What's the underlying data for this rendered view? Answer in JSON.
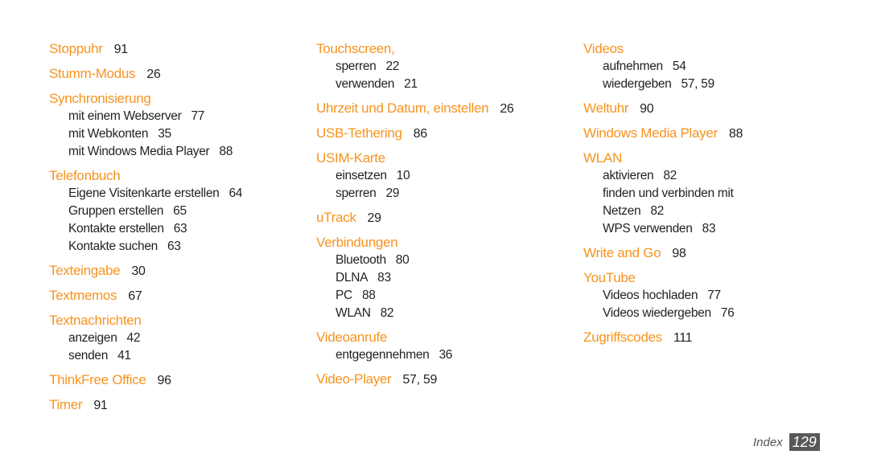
{
  "colors": {
    "accent": "#F7931E",
    "text": "#231F20",
    "page_box": "#58595B"
  },
  "columns": [
    {
      "entries": [
        {
          "term": "Stoppuhr",
          "pages": "91",
          "subs": []
        },
        {
          "term": "Stumm-Modus",
          "pages": "26",
          "subs": []
        },
        {
          "term": "Synchronisierung",
          "pages": "",
          "subs": [
            {
              "term": "mit einem Webserver",
              "pages": "77"
            },
            {
              "term": "mit Webkonten",
              "pages": "35"
            },
            {
              "term": "mit Windows Media Player",
              "pages": "88"
            }
          ]
        },
        {
          "term": "Telefonbuch",
          "pages": "",
          "subs": [
            {
              "term": "Eigene Visitenkarte erstellen",
              "pages": "64"
            },
            {
              "term": "Gruppen erstellen",
              "pages": "65"
            },
            {
              "term": "Kontakte erstellen",
              "pages": "63"
            },
            {
              "term": "Kontakte suchen",
              "pages": "63"
            }
          ]
        },
        {
          "term": "Texteingabe",
          "pages": "30",
          "subs": []
        },
        {
          "term": "Textmemos",
          "pages": "67",
          "subs": []
        },
        {
          "term": "Textnachrichten",
          "pages": "",
          "subs": [
            {
              "term": "anzeigen",
              "pages": "42"
            },
            {
              "term": "senden",
              "pages": "41"
            }
          ]
        },
        {
          "term": "ThinkFree Office",
          "pages": "96",
          "subs": []
        },
        {
          "term": "Timer",
          "pages": "91",
          "subs": []
        }
      ]
    },
    {
      "entries": [
        {
          "term": "Touchscreen,",
          "pages": "",
          "subs": [
            {
              "term": "sperren",
              "pages": "22"
            },
            {
              "term": "verwenden",
              "pages": "21"
            }
          ]
        },
        {
          "term": "Uhrzeit und Datum, einstellen",
          "pages": "26",
          "subs": []
        },
        {
          "term": "USB-Tethering",
          "pages": "86",
          "subs": []
        },
        {
          "term": "USIM-Karte",
          "pages": "",
          "subs": [
            {
              "term": "einsetzen",
              "pages": "10"
            },
            {
              "term": "sperren",
              "pages": "29"
            }
          ]
        },
        {
          "term": "uTrack",
          "pages": "29",
          "subs": []
        },
        {
          "term": "Verbindungen",
          "pages": "",
          "subs": [
            {
              "term": "Bluetooth",
              "pages": "80"
            },
            {
              "term": "DLNA",
              "pages": "83"
            },
            {
              "term": "PC",
              "pages": "88"
            },
            {
              "term": "WLAN",
              "pages": "82"
            }
          ]
        },
        {
          "term": "Videoanrufe",
          "pages": "",
          "subs": [
            {
              "term": "entgegennehmen",
              "pages": "36"
            }
          ]
        },
        {
          "term": "Video-Player",
          "pages": "57, 59",
          "subs": []
        }
      ]
    },
    {
      "entries": [
        {
          "term": "Videos",
          "pages": "",
          "subs": [
            {
              "term": "aufnehmen",
              "pages": "54"
            },
            {
              "term": "wiedergeben",
              "pages": "57, 59"
            }
          ]
        },
        {
          "term": "Weltuhr",
          "pages": "90",
          "subs": []
        },
        {
          "term": "Windows Media Player",
          "pages": "88",
          "subs": []
        },
        {
          "term": "WLAN",
          "pages": "",
          "subs": [
            {
              "term": "aktivieren",
              "pages": "82"
            },
            {
              "term": "finden und verbinden mit",
              "pages": ""
            },
            {
              "term": "Netzen",
              "pages": "82"
            },
            {
              "term": "WPS verwenden",
              "pages": "83"
            }
          ]
        },
        {
          "term": "Write and Go",
          "pages": "98",
          "subs": []
        },
        {
          "term": "YouTube",
          "pages": "",
          "subs": [
            {
              "term": "Videos hochladen",
              "pages": "77"
            },
            {
              "term": "Videos wiedergeben",
              "pages": "76"
            }
          ]
        },
        {
          "term": "Zugriffscodes",
          "pages": "111",
          "subs": []
        }
      ]
    }
  ],
  "footer": {
    "section_label": "Index",
    "page_number": "129"
  }
}
